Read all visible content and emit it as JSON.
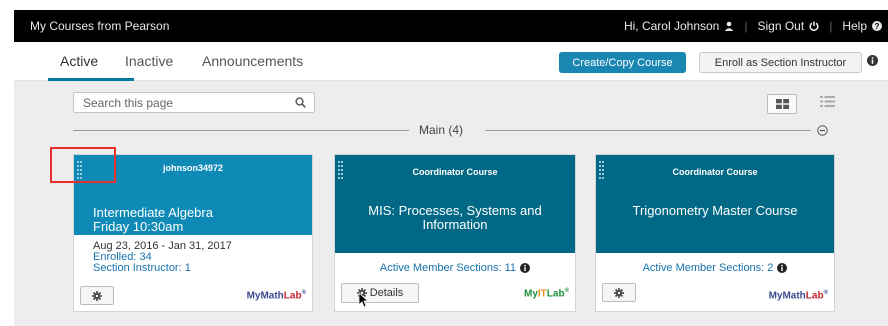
{
  "topbar": {
    "title": "My Courses from Pearson",
    "greeting": "Hi, Carol Johnson",
    "sign_out": "Sign Out",
    "help": "Help"
  },
  "tabs": [
    {
      "label": "Active",
      "active": true
    },
    {
      "label": "Inactive",
      "active": false
    },
    {
      "label": "Announcements",
      "active": false
    }
  ],
  "actions": {
    "create_copy": "Create/Copy Course",
    "enroll": "Enroll as Section Instructor"
  },
  "search": {
    "placeholder": "Search this page"
  },
  "section": {
    "label": "Main (4)"
  },
  "cards": [
    {
      "header": "johnson34972",
      "title_line1": "Intermediate Algebra",
      "title_line2": "Friday 10:30am",
      "dates": "Aug 23, 2016 - Jan 31, 2017",
      "enrolled": "Enrolled: 34",
      "section_instructor": "Section Instructor: 1",
      "brand_a": "MyMath",
      "brand_b": "Lab",
      "brand_reg": "®"
    },
    {
      "header": "Coordinator Course",
      "title_line1": "MIS: Processes, Systems and",
      "title_line2": "Information",
      "member_sections": "Active Member Sections: 11",
      "details": "Details",
      "brand_a": "My",
      "brand_b": "IT",
      "brand_c": "Lab",
      "brand_reg": "®"
    },
    {
      "header": "Coordinator Course",
      "title_line1": "Trigonometry Master Course",
      "member_sections": "Active Member Sections: 2",
      "brand_a": "MyMath",
      "brand_b": "Lab",
      "brand_reg": "®"
    }
  ],
  "colors": {
    "accent": "#1a86b2",
    "card_header_light": "#0f8ab7",
    "card_header_dark": "#016986",
    "link": "#1773ae",
    "highlight": "#e53030"
  }
}
